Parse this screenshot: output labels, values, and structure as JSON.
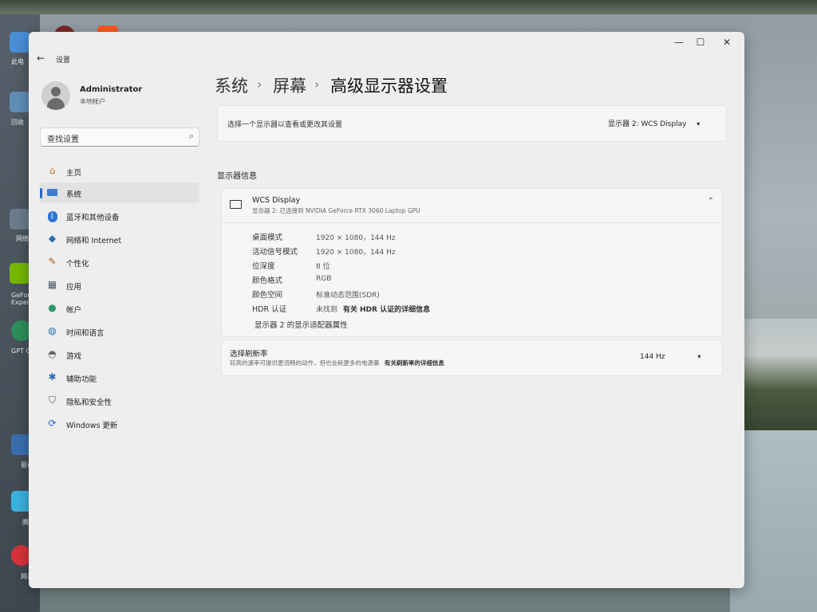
{
  "window": {
    "title": "设置",
    "back_glyph": "←",
    "controls": {
      "minimize": "—",
      "maximize": "☐",
      "close": "✕"
    }
  },
  "user": {
    "name": "Administrator",
    "type": "本地帐户"
  },
  "search": {
    "placeholder": "查找设置"
  },
  "sidebar": {
    "items": [
      {
        "label": "主页",
        "icon": "home-icon"
      },
      {
        "label": "系统",
        "icon": "system-icon",
        "active": true
      },
      {
        "label": "蓝牙和其他设备",
        "icon": "bluetooth-icon"
      },
      {
        "label": "网络和 Internet",
        "icon": "wifi-icon"
      },
      {
        "label": "个性化",
        "icon": "brush-icon"
      },
      {
        "label": "应用",
        "icon": "apps-icon"
      },
      {
        "label": "帐户",
        "icon": "account-icon"
      },
      {
        "label": "时间和语言",
        "icon": "globe-icon"
      },
      {
        "label": "游戏",
        "icon": "gamepad-icon"
      },
      {
        "label": "辅助功能",
        "icon": "accessibility-icon"
      },
      {
        "label": "隐私和安全性",
        "icon": "shield-icon"
      },
      {
        "label": "Windows 更新",
        "icon": "update-icon"
      }
    ]
  },
  "breadcrumb": {
    "part1": "系统",
    "part2": "屏幕",
    "current": "高级显示器设置",
    "separator": "›"
  },
  "select_display": {
    "label": "选择一个显示器以查看或更改其设置",
    "value": "显示器 2: WCS Display"
  },
  "display_info": {
    "section_title": "显示器信息",
    "name": "WCS Display",
    "subtitle": "显示器 2: 已连接到 NVIDIA GeForce RTX 3060 Laptop GPU",
    "rows": [
      {
        "key": "桌面模式",
        "value": "1920 × 1080，144 Hz"
      },
      {
        "key": "活动信号模式",
        "value": "1920 × 1080，144 Hz"
      },
      {
        "key": "位深度",
        "value": "8 位"
      },
      {
        "key": "颜色格式",
        "value": "RGB"
      },
      {
        "key": "颜色空间",
        "value": "标准动态范围(SDR)"
      }
    ],
    "hdr": {
      "key": "HDR 认证",
      "value": "未找到",
      "link": "有关 HDR 认证的详细信息"
    },
    "adapter_link": "显示器 2 的显示适配器属性"
  },
  "refresh": {
    "label": "选择刷新率",
    "desc": "较高的速率可提供更流畅的动作，但也会耗更多的电源量",
    "link": "有关刷新率的详细信息",
    "value": "144 Hz"
  },
  "desktop_icons": [
    {
      "label": "此电",
      "color": "#4a8fd8"
    },
    {
      "label": "回收",
      "color": "#5f8fb8"
    },
    {
      "label": "网络",
      "color": "#6b7c8c"
    },
    {
      "label": "GeFor Experie",
      "color": "#76b900"
    },
    {
      "label": "GPT Ch",
      "color": "#2d8f5a"
    },
    {
      "label": "驱动",
      "color": "#3a6fb0"
    },
    {
      "label": "腾讯",
      "color": "#3bb3e0"
    },
    {
      "label": "网易云",
      "color": "#d9323b"
    }
  ],
  "colors": {
    "accent": "#2667c9",
    "link": "#1a4f9c"
  }
}
